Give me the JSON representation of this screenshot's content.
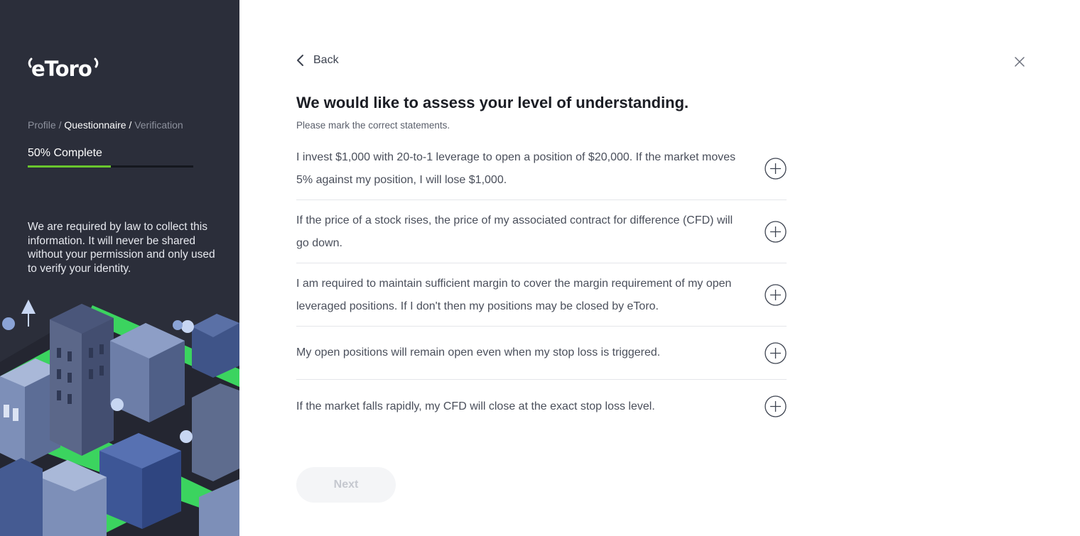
{
  "brand": {
    "logo_text": "etoro",
    "accent": "#69c62d",
    "sidebar_bg": "#2b2e3a"
  },
  "sidebar": {
    "breadcrumb": {
      "step1": "Profile",
      "sep1": " / ",
      "step2": "Questionnaire",
      "sep2": " / ",
      "step3": "Verification"
    },
    "progress": {
      "label": "50% Complete",
      "value": 0.5
    },
    "legal_text": "We are required by law to collect this information. It will never be shared without your permission and only used to verify your identity."
  },
  "header": {
    "back_label": "Back",
    "close_icon": "close-icon"
  },
  "main": {
    "title": "We would like to assess your level of understanding.",
    "subtitle": "Please mark the correct statements.",
    "statements": [
      {
        "text": "I invest $1,000 with 20-to-1 leverage to open a position of $20,000. If the market moves 5% against my position, I will lose $1,000."
      },
      {
        "text": "If the price of a stock rises, the price of my associated contract for difference (CFD) will go down."
      },
      {
        "text": "I am required to maintain sufficient margin to cover the margin requirement of my open leveraged positions. If I don't then my positions may be closed by eToro."
      },
      {
        "text": "My open positions will remain open even when my stop loss is triggered."
      },
      {
        "text": "If the market falls rapidly, my CFD will close at the exact stop loss level."
      }
    ],
    "next_label": "Next"
  }
}
